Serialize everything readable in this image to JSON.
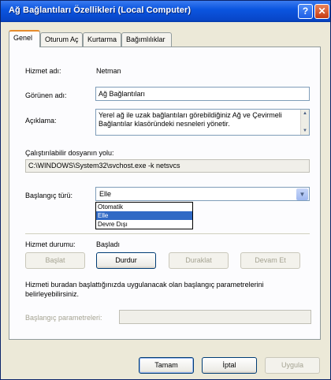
{
  "window": {
    "title": "Ağ Bağlantıları Özellikleri (Local Computer)"
  },
  "title_buttons": {
    "help": "?",
    "close": "✕"
  },
  "tabs": [
    {
      "label": "Genel",
      "active": true
    },
    {
      "label": "Oturum Aç",
      "active": false
    },
    {
      "label": "Kurtarma",
      "active": false
    },
    {
      "label": "Bağımlılıklar",
      "active": false
    }
  ],
  "fields": {
    "service_name_label": "Hizmet adı:",
    "service_name_value": "Netman",
    "display_name_label": "Görünen adı:",
    "display_name_value": "Ağ Bağlantıları",
    "description_label": "Açıklama:",
    "description_value": "Yerel ağ ile uzak bağlantıları görebildiğiniz Ağ ve Çevirmeli Bağlantılar klasöründeki nesneleri yönetir.",
    "path_label": "Çalıştırılabilir dosyanın yolu:",
    "path_value": "C:\\WINDOWS\\System32\\svchost.exe -k netsvcs",
    "startup_type_label": "Başlangıç türü:",
    "startup_type_value": "Elle",
    "startup_options": [
      "Otomatik",
      "Elle",
      "Devre Dışı"
    ],
    "startup_selected_index": 1,
    "service_status_label": "Hizmet durumu:",
    "service_status_value": "Başladı"
  },
  "service_buttons": {
    "start": "Başlat",
    "stop": "Durdur",
    "pause": "Duraklat",
    "resume": "Devam Et"
  },
  "params": {
    "help_text": "Hizmeti buradan başlattığınızda uygulanacak olan başlangıç parametrelerini belirleyebilirsiniz.",
    "label": "Başlangıç parametreleri:",
    "value": ""
  },
  "footer": {
    "ok": "Tamam",
    "cancel": "İptal",
    "apply": "Uygula"
  }
}
